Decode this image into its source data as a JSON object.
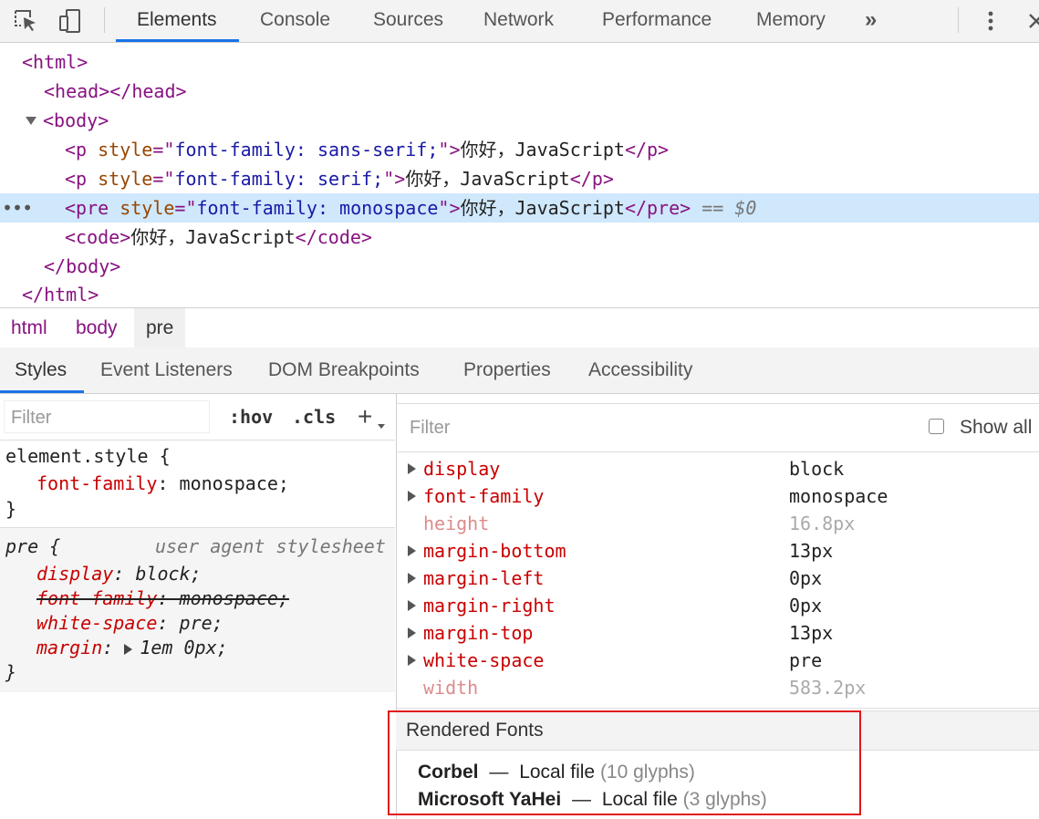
{
  "toolbar": {
    "tabs": [
      "Elements",
      "Console",
      "Sources",
      "Network",
      "Performance",
      "Memory"
    ],
    "more_label": "»",
    "icons": [
      "inspect-element-icon",
      "device-toolbar-icon",
      "more-vertical-icon",
      "close-icon"
    ]
  },
  "dom": {
    "lines": [
      {
        "parts": [
          "<",
          "html",
          ">"
        ]
      },
      {
        "parts": [
          "<",
          "head",
          "></",
          "head",
          ">"
        ]
      },
      {
        "parts": [
          "<",
          "body",
          ">"
        ]
      },
      {
        "tag_open": "<p",
        "attr": " style",
        "eq": "=\"",
        "val": "font-family: sans-serif;",
        "close": "\">",
        "text": "你好，JavaScript",
        "end_tag": "</p>"
      },
      {
        "tag_open": "<p",
        "attr": " style",
        "eq": "=\"",
        "val": "font-family: serif;",
        "close": "\">",
        "text": "你好，JavaScript",
        "end_tag": "</p>"
      },
      {
        "tag_open": "<pre",
        "attr": " style",
        "eq": "=\"",
        "val": "font-family: monospace",
        "close": "\">",
        "text": "你好，JavaScript",
        "end_tag": "</pre>",
        "suffix": " == $0"
      },
      {
        "tag_open": "<code>",
        "text": "你好，JavaScript",
        "end_tag": "</code>"
      },
      {
        "parts": [
          "</",
          "body",
          ">"
        ]
      },
      {
        "parts": [
          "</",
          "html",
          ">"
        ]
      }
    ],
    "ellipsis": "•••"
  },
  "breadcrumb": [
    "html",
    "body",
    "pre"
  ],
  "subtabs": [
    "Styles",
    "Event Listeners",
    "DOM Breakpoints",
    "Properties",
    "Accessibility"
  ],
  "styles": {
    "filter_placeholder": "Filter",
    "hov": ":hov",
    "cls": ".cls",
    "plus": "+",
    "element_style": {
      "selector": "element.style {",
      "prop": "font-family",
      "value": "monospace;",
      "close": "}"
    },
    "ua_rule": {
      "selector": "pre {",
      "source": "user agent stylesheet",
      "decls": [
        {
          "prop": "display",
          "value": "block;"
        },
        {
          "prop": "font-family",
          "value": "monospace;",
          "struck": true
        },
        {
          "prop": "white-space",
          "value": "pre;"
        },
        {
          "prop": "margin",
          "value": "1em 0px;",
          "expandable": true
        }
      ],
      "close": "}"
    }
  },
  "computed": {
    "filter_placeholder": "Filter",
    "show_all_label": "Show all",
    "show_all_checked": false,
    "rows": [
      {
        "name": "display",
        "value": "block",
        "expandable": true,
        "inherited": false
      },
      {
        "name": "font-family",
        "value": "monospace",
        "expandable": true,
        "inherited": false
      },
      {
        "name": "height",
        "value": "16.8px",
        "expandable": false,
        "inherited": true
      },
      {
        "name": "margin-bottom",
        "value": "13px",
        "expandable": true,
        "inherited": false
      },
      {
        "name": "margin-left",
        "value": "0px",
        "expandable": true,
        "inherited": false
      },
      {
        "name": "margin-right",
        "value": "0px",
        "expandable": true,
        "inherited": false
      },
      {
        "name": "margin-top",
        "value": "13px",
        "expandable": true,
        "inherited": false
      },
      {
        "name": "white-space",
        "value": "pre",
        "expandable": true,
        "inherited": false
      },
      {
        "name": "width",
        "value": "583.2px",
        "expandable": false,
        "inherited": true
      }
    ]
  },
  "rendered_fonts": {
    "title": "Rendered Fonts",
    "entries": [
      {
        "font": "Corbel",
        "dash": "—",
        "source": "Local file",
        "count": "(10 glyphs)"
      },
      {
        "font": "Microsoft YaHei",
        "dash": "—",
        "source": "Local file",
        "count": "(3 glyphs)"
      }
    ]
  },
  "colors": {
    "accent": "#1a73e8",
    "tag": "#881280",
    "attr": "#994500",
    "attr_value": "#1a1aa6",
    "css_prop": "#c80000",
    "selection": "#cfe8fc",
    "highlight_box": "#e0161c"
  }
}
